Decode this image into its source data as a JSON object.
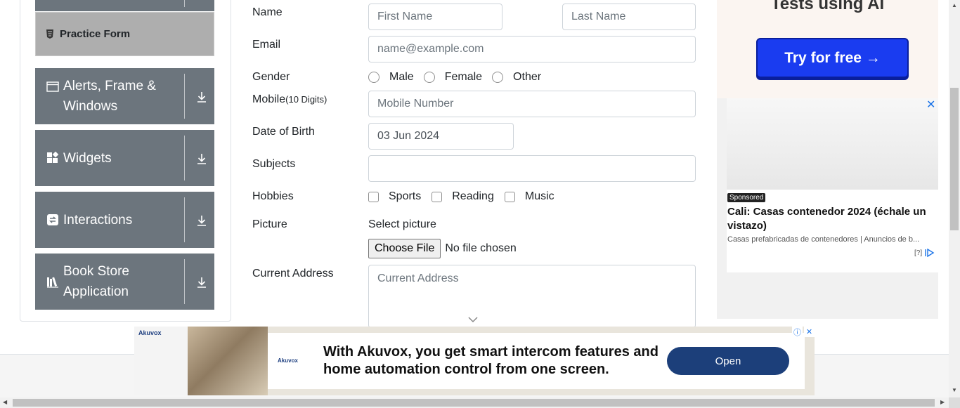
{
  "sidebar": {
    "active_item": {
      "label": "Practice Form",
      "icon": "html5-icon"
    },
    "groups": [
      {
        "label": "Alerts, Frame & Windows",
        "icon": "window-icon"
      },
      {
        "label": "Widgets",
        "icon": "widgets-icon"
      },
      {
        "label": "Interactions",
        "icon": "interactions-icon"
      },
      {
        "label": "Book Store Application",
        "icon": "bookstore-icon"
      }
    ]
  },
  "form": {
    "name_label": "Name",
    "first_name_placeholder": "First Name",
    "last_name_placeholder": "Last Name",
    "email_label": "Email",
    "email_placeholder": "name@example.com",
    "gender_label": "Gender",
    "gender_options": [
      "Male",
      "Female",
      "Other"
    ],
    "mobile_label": "Mobile",
    "mobile_hint": "(10 Digits)",
    "mobile_placeholder": "Mobile Number",
    "dob_label": "Date of Birth",
    "dob_value": "03 Jun 2024",
    "subjects_label": "Subjects",
    "hobbies_label": "Hobbies",
    "hobbies_options": [
      "Sports",
      "Reading",
      "Music"
    ],
    "picture_label": "Picture",
    "select_picture_text": "Select picture",
    "choose_file_label": "Choose File",
    "no_file_text": "No file chosen",
    "address_label": "Current Address",
    "address_placeholder": "Current Address"
  },
  "right_ad": {
    "heading": "Tests using AI",
    "cta": "Try for free →",
    "close": "✕",
    "sponsored": "Sponsored",
    "title": "Cali: Casas contenedor 2024 (échale un vistazo)",
    "subtitle": "Casas prefabricadas de contenedores | Anuncios de b...",
    "info": "[?]"
  },
  "bottom_ad": {
    "brand": "Akuvox",
    "headline": "With Akuvox, you get smart intercom features and home automation control from one screen.",
    "cta": "Open",
    "info_icon": "ⓘ",
    "close": "✕"
  },
  "colors": {
    "sidebar_group_bg": "#6c757d",
    "active_item_bg": "#aeaeae",
    "ad_button_blue": "#1a3cf0",
    "open_button_navy": "#1c3f7a"
  }
}
